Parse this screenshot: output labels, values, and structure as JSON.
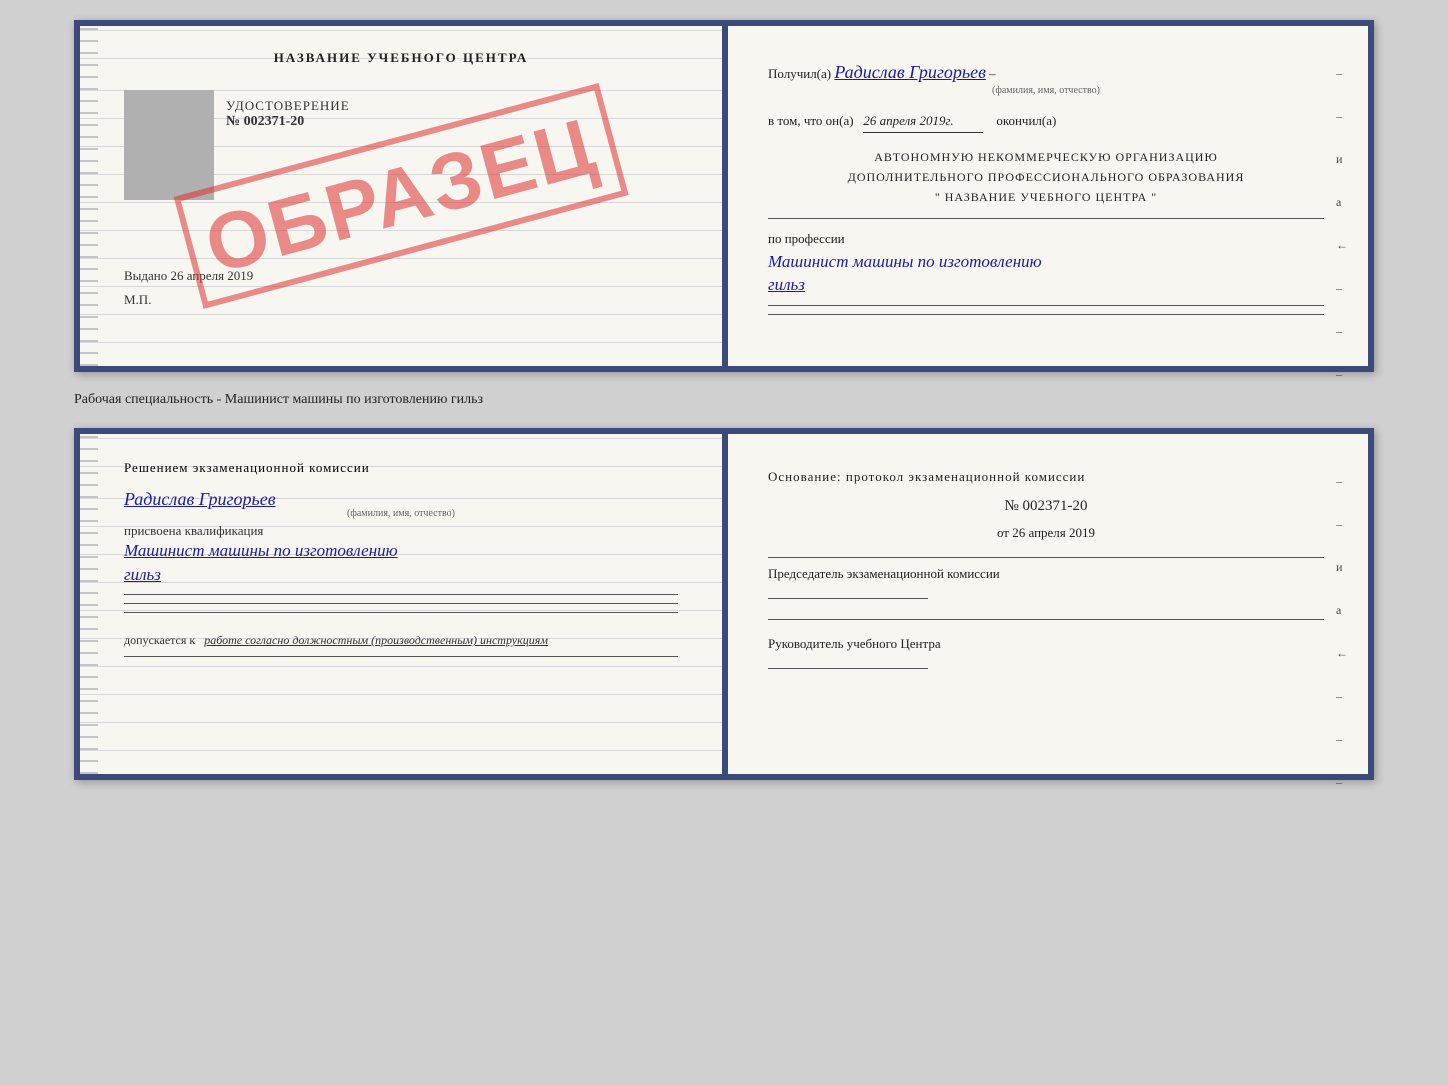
{
  "top_book": {
    "left": {
      "uch_center": "НАЗВАНИЕ УЧЕБНОГО ЦЕНТРА",
      "udostoverenie_label": "УДОСТОВЕРЕНИЕ",
      "number": "№ 002371-20",
      "vydano": "Выдано",
      "vydano_date": "26 апреля 2019",
      "mp": "М.П.",
      "stamp_text": "ОБРАЗЕЦ"
    },
    "right": {
      "poluchil_prefix": "Получил(а)",
      "name": "Радислав Григорьев",
      "fio_hint": "(фамилия, имя, отчество)",
      "vtom_prefix": "в том, что он(а)",
      "date": "26 апреля 2019г.",
      "okonchil": "окончил(а)",
      "org_line1": "АВТОНОМНУЮ НЕКОММЕРЧЕСКУЮ ОРГАНИЗАЦИЮ",
      "org_line2": "ДОПОЛНИТЕЛЬНОГО ПРОФЕССИОНАЛЬНОГО ОБРАЗОВАНИЯ",
      "org_line3": "\"  НАЗВАНИЕ УЧЕБНОГО ЦЕНТРА  \"",
      "po_professii": "по профессии",
      "profession_line1": "Машинист машины по изготовлению",
      "profession_line2": "гильз"
    }
  },
  "caption": "Рабочая специальность - Машинист машины по изготовлению гильз",
  "bottom_book": {
    "left": {
      "resheniem": "Решением  экзаменационной  комиссии",
      "name": "Радислав Григорьев",
      "fio_hint": "(фамилия, имя, отчество)",
      "prisvoena": "присвоена квалификация",
      "kvali_line1": "Машинист машины по изготовлению",
      "kvali_line2": "гильз",
      "dopusk_prefix": "допускается к",
      "dopusk_text": "работе согласно должностным (производственным) инструкциям"
    },
    "right": {
      "osnov_prefix": "Основание: протокол экзаменационной  комиссии",
      "number": "№  002371-20",
      "ot_prefix": "от",
      "ot_date": "26 апреля 2019",
      "predsedatel_label": "Председатель экзаменационной комиссии",
      "rukovoditel_label": "Руководитель учебного Центра"
    }
  },
  "side_marks": {
    "items": [
      "–",
      "–",
      "и",
      "а",
      "←",
      "–",
      "–",
      "–"
    ]
  }
}
